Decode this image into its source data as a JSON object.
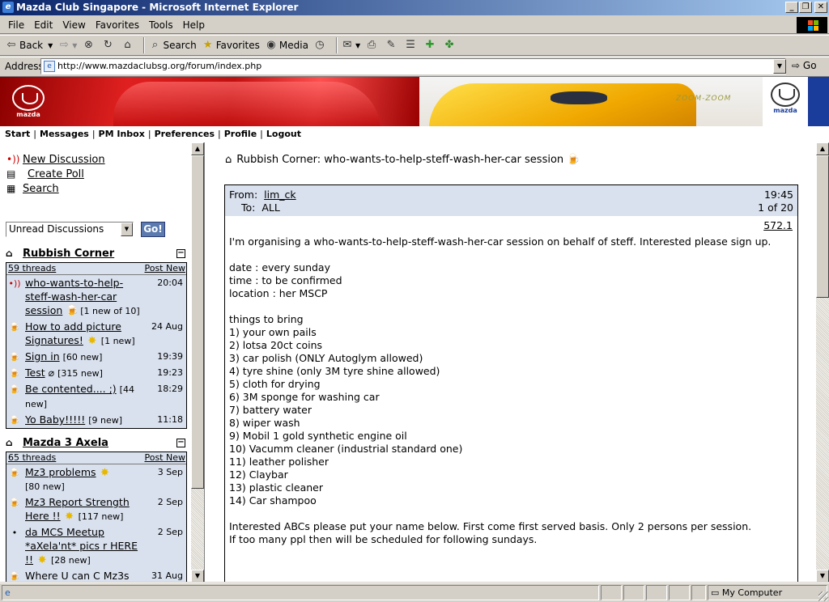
{
  "window": {
    "title": "Mazda Club Singapore - Microsoft Internet Explorer"
  },
  "menu": [
    "File",
    "Edit",
    "View",
    "Favorites",
    "Tools",
    "Help"
  ],
  "toolbar": {
    "back": "Back",
    "search": "Search",
    "favorites": "Favorites",
    "media": "Media"
  },
  "address": {
    "label": "Address",
    "url": "http://www.mazdaclubsg.org/forum/index.php",
    "go": "Go"
  },
  "banner": {
    "logo_text": "mazda",
    "slogan": "ZOOM-ZOOM"
  },
  "nav": [
    "Start",
    "Messages",
    "PM Inbox",
    "Preferences",
    "Profile",
    "Logout"
  ],
  "actions": [
    {
      "icon": "new-discussion-icon",
      "label": "New Discussion"
    },
    {
      "icon": "create-poll-icon",
      "label": "Create Poll"
    },
    {
      "icon": "search-icon",
      "label": "Search"
    }
  ],
  "filter": {
    "selected": "Unread Discussions",
    "go": "Go!"
  },
  "folders": [
    {
      "name": "Rubbish Corner",
      "threads": "59 threads",
      "post_new": "Post New",
      "items": [
        {
          "title": "who-wants-to-help-steff-wash-her-car session",
          "meta": "[1 new of 10]",
          "time": "20:04"
        },
        {
          "title": "How to add picture Signatures!",
          "meta": "[1 new]",
          "time": "24 Aug"
        },
        {
          "title": "Sign in",
          "meta": "[60 new]",
          "time": "19:39"
        },
        {
          "title": "Test",
          "meta": "[315 new]",
          "time": "19:23"
        },
        {
          "title": "Be contented.... ;)",
          "meta": "[44 new]",
          "time": "18:29"
        },
        {
          "title": "Yo Baby!!!!!",
          "meta": "[9 new]",
          "time": "11:18"
        }
      ]
    },
    {
      "name": "Mazda 3 Axela",
      "threads": "65 threads",
      "post_new": "Post New",
      "items": [
        {
          "title": "Mz3 problems",
          "meta": "[80 new]",
          "time": "3 Sep"
        },
        {
          "title": "Mz3 Report Strength Here !!",
          "meta": "[117 new]",
          "time": "2 Sep"
        },
        {
          "title": "da MCS Meetup *aXela'nt* pics r HERE !!",
          "meta": "[28 new]",
          "time": "2 Sep"
        },
        {
          "title": "Where U can C Mz3s",
          "meta": "",
          "time": "31 Aug"
        }
      ]
    }
  ],
  "topic": {
    "folder": "Rubbish Corner:",
    "title": "who-wants-to-help-steff-wash-her-car session"
  },
  "message": {
    "from_label": "From:",
    "from": "lim_ck",
    "to_label": "To:",
    "to": "ALL",
    "time": "19:45",
    "count": "1 of 20",
    "id": "572.1",
    "intro": "I'm organising a who-wants-to-help-steff-wash-her-car session on behalf of steff. Interested please sign up.",
    "details": [
      "date : every sunday",
      "time : to be confirmed",
      "location : her MSCP"
    ],
    "list_title": "things to bring",
    "list": [
      "1) your own pails",
      "2) lotsa 20ct coins",
      "3) car polish (ONLY Autoglym allowed)",
      "4) tyre shine (only 3M tyre shine allowed)",
      "5) cloth for drying",
      "6) 3M sponge for washing car",
      "7) battery water",
      "8) wiper wash",
      "9) Mobil 1 gold synthetic engine oil",
      "10) Vacumm cleaner (industrial standard one)",
      "11) leather polisher",
      "12) Claybar",
      "13) plastic cleaner",
      "14) Car shampoo"
    ],
    "outro_1": "Interested ABCs please put your name below. First come first served basis. Only 2 persons per session.",
    "outro_2": "If too many ppl then will be scheduled for following sundays."
  },
  "status": {
    "zone": "My Computer"
  }
}
